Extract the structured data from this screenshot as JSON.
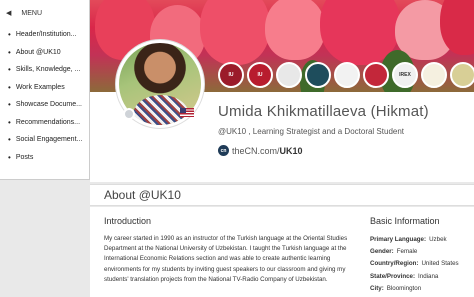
{
  "menu": {
    "title": "MENU",
    "items": [
      "Header/Institution...",
      "About @UK10",
      "Skills, Knowledge, ...",
      "Work Examples",
      "Showcase Docume...",
      "Recommendations...",
      "Social Engagement...",
      "Posts"
    ]
  },
  "profile": {
    "name": "Umida Khikmatillaeva (Hikmat)",
    "subtitle": "@UK10 , Learning Strategist and a Doctoral Student",
    "site_prefix": "theCN.com/",
    "site_handle": "UK10",
    "cn_icon": "cn"
  },
  "badges": [
    {
      "icon": "indiana-university-badge",
      "text": "IU",
      "color": "#9b1b2a"
    },
    {
      "icon": "indiana-university-badge-2",
      "text": "IU",
      "color": "#b81c2e"
    },
    {
      "icon": "organization-badge-1",
      "text": "",
      "color": "#e8e8e8"
    },
    {
      "icon": "organization-badge-2",
      "text": "",
      "color": "#1e4d5c"
    },
    {
      "icon": "organization-badge-3",
      "text": "",
      "color": "#f2f2f2"
    },
    {
      "icon": "organization-badge-4",
      "text": "",
      "color": "#c3273a"
    },
    {
      "icon": "irex-badge",
      "text": "IREX",
      "color": "#f0f0f0"
    },
    {
      "icon": "american-councils-badge",
      "text": "",
      "color": "#f5f0e0"
    },
    {
      "icon": "organization-badge-5",
      "text": "",
      "color": "#d8cf96"
    }
  ],
  "about": {
    "heading": "About @UK10",
    "intro_title": "Introduction",
    "intro_text": "My career started in 1990 as an instructor of the Turkish language at the Oriental Studies Department at the National University of Uzbekistan. I taught the Turkish language at the International Economic Relations section and was able to create authentic learning environments for my students by inviting guest speakers to our classroom and giving my students' translation projects from the National TV-Radio Company of Uzbekistan."
  },
  "basic_info": {
    "title": "Basic Information",
    "rows": [
      {
        "label": "Primary Language:",
        "value": "Uzbek"
      },
      {
        "label": "Gender:",
        "value": "Female"
      },
      {
        "label": "Country/Region:",
        "value": "United States"
      },
      {
        "label": "State/Province:",
        "value": "Indiana"
      },
      {
        "label": "City:",
        "value": "Bloomington"
      }
    ]
  },
  "colors": {
    "banner": "#d9274a",
    "sidebar_bg": "#ffffff",
    "page_bg": "#e9e9e9"
  }
}
